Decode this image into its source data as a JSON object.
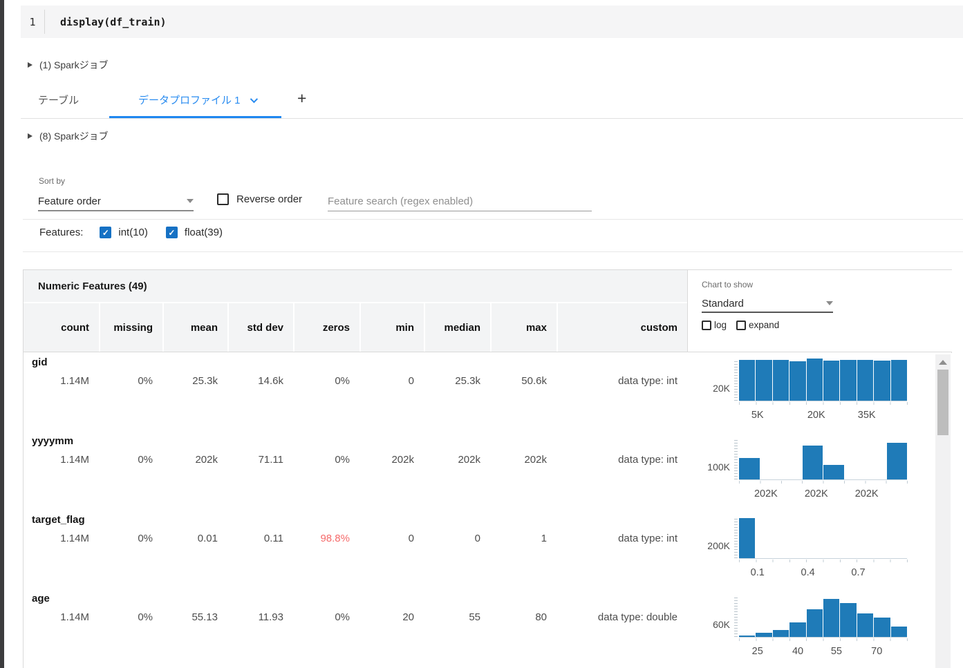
{
  "colors": {
    "accent_blue": "#2a8cf0",
    "tab_underline_blue": "#1f87f0",
    "histogram_bar_blue": "#1f7bb8",
    "alert_red": "#f56a6a",
    "checkbox_checked_blue": "#1671c4",
    "header_band_gray": "#f3f4f5",
    "gutter_bar_dark": "#3c3c3e"
  },
  "code_cell": {
    "line_number": "1",
    "code": "display(df_train)"
  },
  "spark_jobs": {
    "top": "(1) Sparkジョブ",
    "profile": "(8) Sparkジョブ"
  },
  "tabs": {
    "items": [
      {
        "label": "テーブル",
        "active": false
      },
      {
        "label": "データプロファイル 1",
        "active": true,
        "has_dropdown": true
      }
    ],
    "add_label": "+"
  },
  "controls": {
    "sort_by_label": "Sort by",
    "sort_value": "Feature order",
    "reverse_label": "Reverse order",
    "reverse_checked": false,
    "search_placeholder": "Feature search (regex enabled)",
    "features_label": "Features:",
    "feature_filters": [
      {
        "label": "int(10)",
        "checked": true
      },
      {
        "label": "float(39)",
        "checked": true
      }
    ]
  },
  "table": {
    "title": "Numeric Features (49)",
    "columns": [
      "count",
      "missing",
      "mean",
      "std dev",
      "zeros",
      "min",
      "median",
      "max",
      "custom"
    ],
    "chart_controls": {
      "label": "Chart to show",
      "value": "Standard",
      "log_label": "log",
      "log_checked": false,
      "expand_label": "expand",
      "expand_checked": false
    },
    "rows": [
      {
        "name": "gid",
        "count": "1.14M",
        "missing": "0%",
        "mean": "25.3k",
        "std_dev": "14.6k",
        "zeros": "0%",
        "zeros_alert": false,
        "min": "0",
        "median": "25.3k",
        "max": "50.6k",
        "custom": "data type: int"
      },
      {
        "name": "yyyymm",
        "count": "1.14M",
        "missing": "0%",
        "mean": "202k",
        "std_dev": "71.11",
        "zeros": "0%",
        "zeros_alert": false,
        "min": "202k",
        "median": "202k",
        "max": "202k",
        "custom": "data type: int"
      },
      {
        "name": "target_flag",
        "count": "1.14M",
        "missing": "0%",
        "mean": "0.01",
        "std_dev": "0.11",
        "zeros": "98.8%",
        "zeros_alert": true,
        "min": "0",
        "median": "0",
        "max": "1",
        "custom": "data type: int"
      },
      {
        "name": "age",
        "count": "1.14M",
        "missing": "0%",
        "mean": "55.13",
        "std_dev": "11.93",
        "zeros": "0%",
        "zeros_alert": false,
        "min": "20",
        "median": "55",
        "max": "80",
        "custom": "data type: double"
      }
    ]
  },
  "chart_data": [
    {
      "type": "bar",
      "feature": "gid",
      "x_tick_labels": [
        "5K",
        "20K",
        "35K"
      ],
      "x_tick_positions": [
        0.11,
        0.46,
        0.76
      ],
      "y_gridline": {
        "label": "20K",
        "fraction_from_bottom": 0.28
      },
      "relative_heights": [
        0.97,
        0.96,
        0.97,
        0.94,
        1.0,
        0.95,
        0.97,
        0.96,
        0.95,
        0.97
      ],
      "estimated_counts": [
        69000,
        68000,
        69000,
        67000,
        71000,
        68000,
        69000,
        68000,
        68000,
        69000
      ]
    },
    {
      "type": "bar",
      "feature": "yyyymm",
      "x_tick_labels": [
        "202K",
        "202K",
        "202K"
      ],
      "x_tick_positions": [
        0.16,
        0.46,
        0.76
      ],
      "y_gridline": {
        "label": "100K",
        "fraction_from_bottom": 0.28
      },
      "relative_heights": [
        0.51,
        0,
        0,
        0.81,
        0.34,
        0,
        0,
        0.87
      ],
      "estimated_counts": [
        182000,
        0,
        0,
        289000,
        121000,
        0,
        0,
        311000
      ]
    },
    {
      "type": "bar",
      "feature": "target_flag",
      "x_tick_labels": [
        "0.1",
        "0.4",
        "0.7"
      ],
      "x_tick_positions": [
        0.11,
        0.41,
        0.71
      ],
      "y_gridline": {
        "label": "200K",
        "fraction_from_bottom": 0.28
      },
      "relative_heights": [
        0.95,
        0,
        0,
        0,
        0,
        0,
        0,
        0,
        0,
        0
      ],
      "estimated_counts": [
        1126000,
        0,
        0,
        0,
        0,
        0,
        0,
        0,
        0,
        0
      ]
    },
    {
      "type": "bar",
      "feature": "age",
      "x_tick_labels": [
        "25",
        "40",
        "55",
        "70"
      ],
      "x_tick_positions": [
        0.11,
        0.35,
        0.58,
        0.82
      ],
      "y_gridline": {
        "label": "60K",
        "fraction_from_bottom": 0.28
      },
      "relative_heights": [
        0.03,
        0.1,
        0.17,
        0.34,
        0.66,
        0.9,
        0.8,
        0.55,
        0.46,
        0.25
      ],
      "estimated_counts": [
        6000,
        21000,
        36000,
        73000,
        141000,
        193000,
        171000,
        118000,
        98000,
        54000
      ]
    }
  ]
}
